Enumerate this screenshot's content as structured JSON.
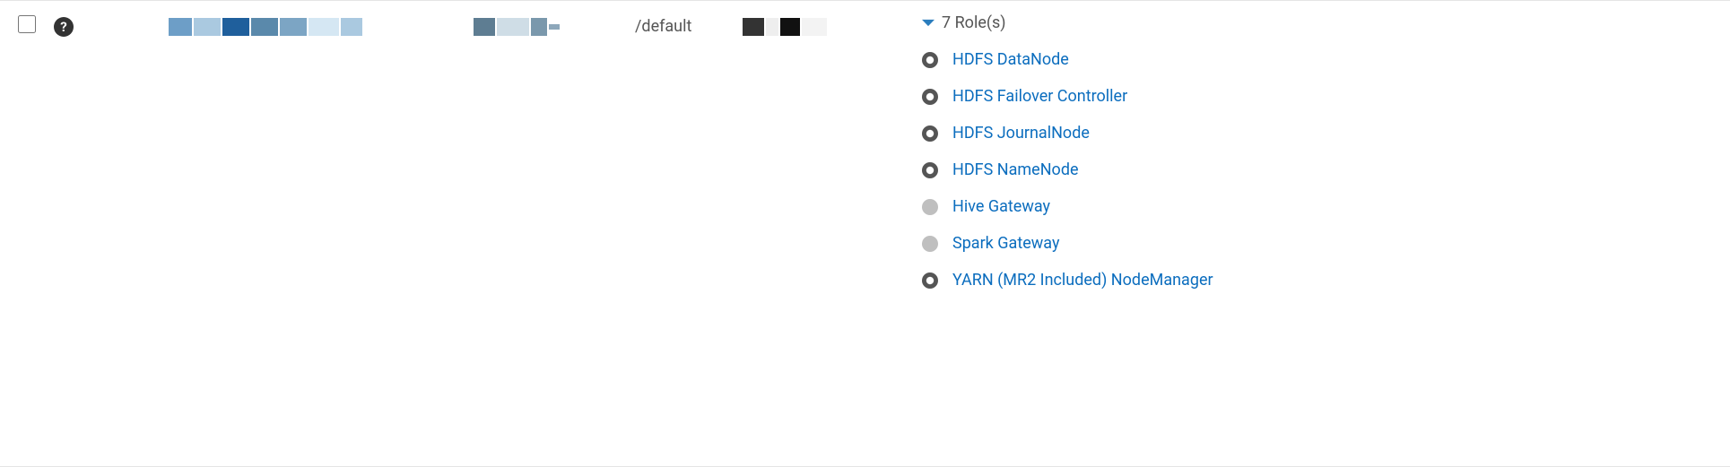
{
  "row": {
    "rack": "/default",
    "roles_summary": "7 Role(s)",
    "roles": [
      {
        "status": "stopped",
        "label": "HDFS DataNode"
      },
      {
        "status": "stopped",
        "label": "HDFS Failover Controller"
      },
      {
        "status": "stopped",
        "label": "HDFS JournalNode"
      },
      {
        "status": "stopped",
        "label": "HDFS NameNode"
      },
      {
        "status": "none",
        "label": "Hive Gateway"
      },
      {
        "status": "none",
        "label": "Spark Gateway"
      },
      {
        "status": "stopped",
        "label": "YARN (MR2 Included) NodeManager"
      }
    ]
  }
}
